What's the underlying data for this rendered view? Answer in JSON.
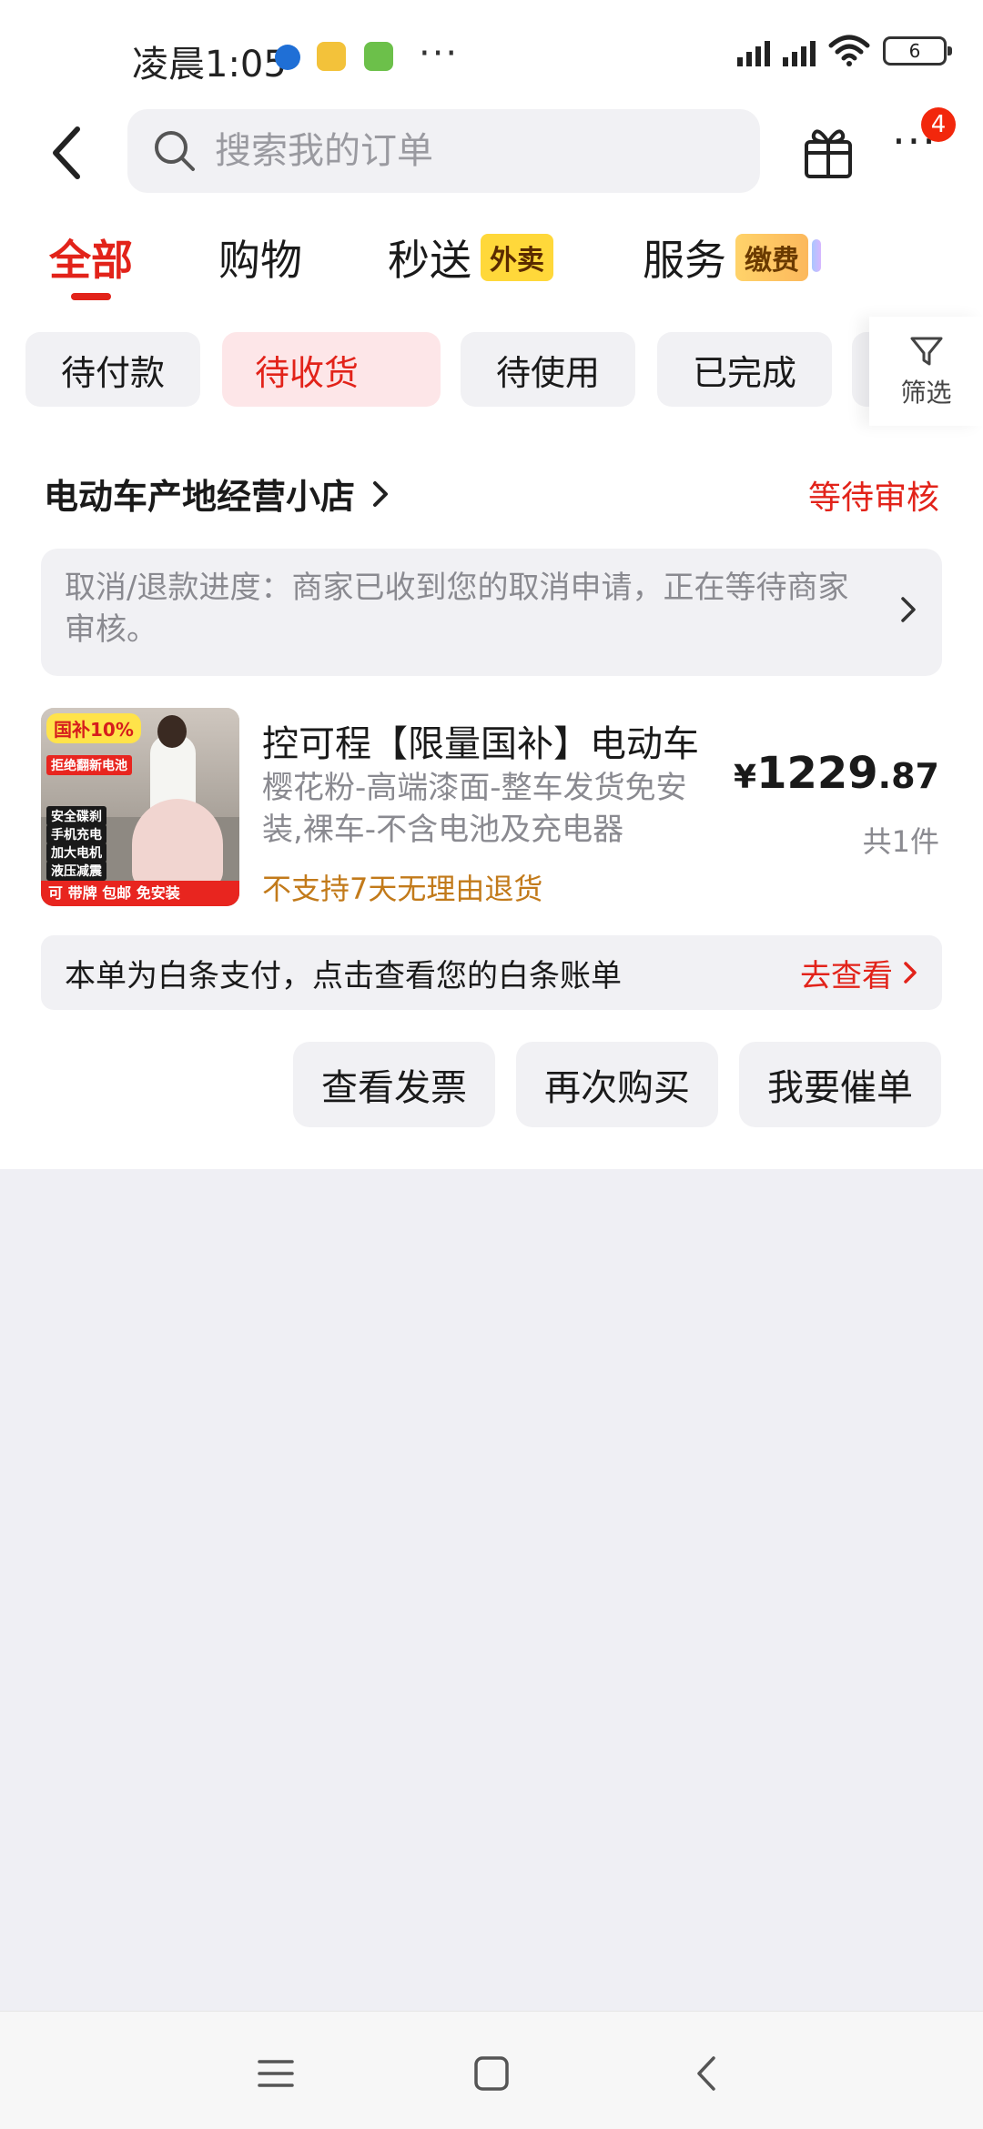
{
  "status_bar": {
    "time": "凌晨1:05",
    "battery": "6",
    "more": "···"
  },
  "header": {
    "search_placeholder": "搜索我的订单",
    "badge_count": "4"
  },
  "tabs": [
    {
      "label": "全部",
      "tag": ""
    },
    {
      "label": "购物",
      "tag": ""
    },
    {
      "label": "秒送",
      "tag": "外卖"
    },
    {
      "label": "服务",
      "tag": "缴费"
    }
  ],
  "filters": [
    "待付款",
    "待收货",
    "待使用",
    "已完成"
  ],
  "filter_label": "筛选",
  "order": {
    "shop_name": "电动车产地经营小店",
    "status": "等待审核",
    "progress": "取消/退款进度：商家已收到您的取消申请，正在等待商家审核。",
    "product": {
      "title": "控可程【限量国补】电动车",
      "spec": "樱花粉-高端漆面-整车发货免安装,裸车-不含电池及充电器",
      "note": "不支持7天无理由退货",
      "price_currency": "¥",
      "price_int": "1229",
      "price_dec": ".87",
      "quantity": "共1件",
      "image_text": {
        "tag1": "国补10%",
        "tag2": "拒绝翻新电池",
        "f1": "安全碟刹",
        "f2": "手机充电",
        "f3": "加大电机",
        "f4": "液压减震",
        "bottom": "可 带牌  包邮  免安装"
      }
    },
    "baitiao_text": "本单为白条支付，点击查看您的白条账单",
    "baitiao_link": "去查看",
    "actions": [
      "查看发票",
      "再次购买",
      "我要催单"
    ]
  },
  "colors": {
    "accent": "#e2231a",
    "chip_bg": "#f1f1f4",
    "chip_active_bg": "#fde6e8",
    "page_bg": "#efeff4"
  }
}
